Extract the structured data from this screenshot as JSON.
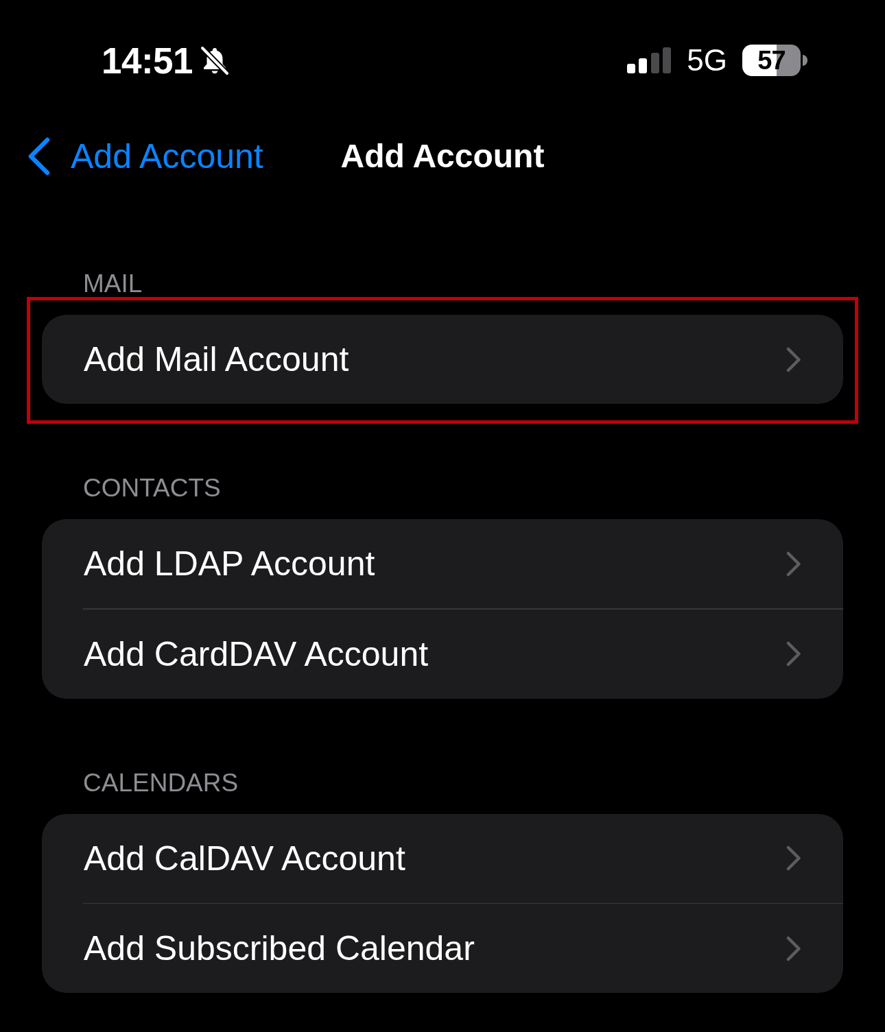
{
  "status_bar": {
    "time": "14:51",
    "silent_mode": true,
    "network": "5G",
    "battery": "57"
  },
  "nav_bar": {
    "back_label": "Add Account",
    "title": "Add Account"
  },
  "sections": [
    {
      "header": "MAIL",
      "highlighted": true,
      "rows": [
        {
          "label": "Add Mail Account"
        }
      ]
    },
    {
      "header": "CONTACTS",
      "highlighted": false,
      "rows": [
        {
          "label": "Add LDAP Account"
        },
        {
          "label": "Add CardDAV Account"
        }
      ]
    },
    {
      "header": "CALENDARS",
      "highlighted": false,
      "rows": [
        {
          "label": "Add CalDAV Account"
        },
        {
          "label": "Add Subscribed Calendar"
        }
      ]
    }
  ]
}
